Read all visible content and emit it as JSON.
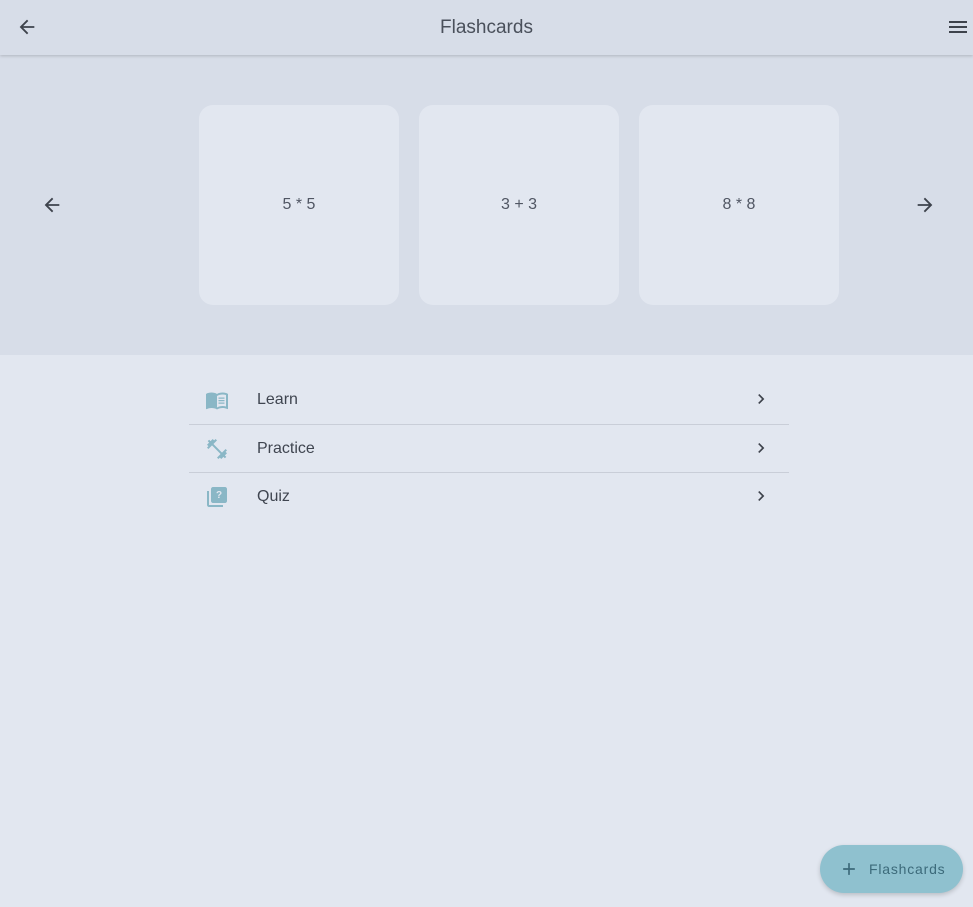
{
  "app_bar": {
    "title": "Flashcards",
    "back_icon": "arrow-back-icon",
    "menu_icon": "hamburger-menu-icon"
  },
  "carousel": {
    "prev_icon": "arrow-left-icon",
    "next_icon": "arrow-right-icon",
    "cards": [
      {
        "text": "5 * 5"
      },
      {
        "text": "3 + 3"
      },
      {
        "text": "8 * 8"
      }
    ]
  },
  "menu": {
    "items": [
      {
        "label": "Learn",
        "icon": "book-open-icon"
      },
      {
        "label": "Practice",
        "icon": "dumbbell-icon"
      },
      {
        "label": "Quiz",
        "icon": "quiz-icon"
      }
    ],
    "chevron_icon": "chevron-right-icon"
  },
  "fab": {
    "label": "Flashcards",
    "icon": "plus-icon"
  },
  "colors": {
    "app_bar_bg": "#d7dde8",
    "page_bg": "#e2e7f0",
    "accent": "#8fc1cf",
    "icon_tint": "#8ab7c6"
  }
}
